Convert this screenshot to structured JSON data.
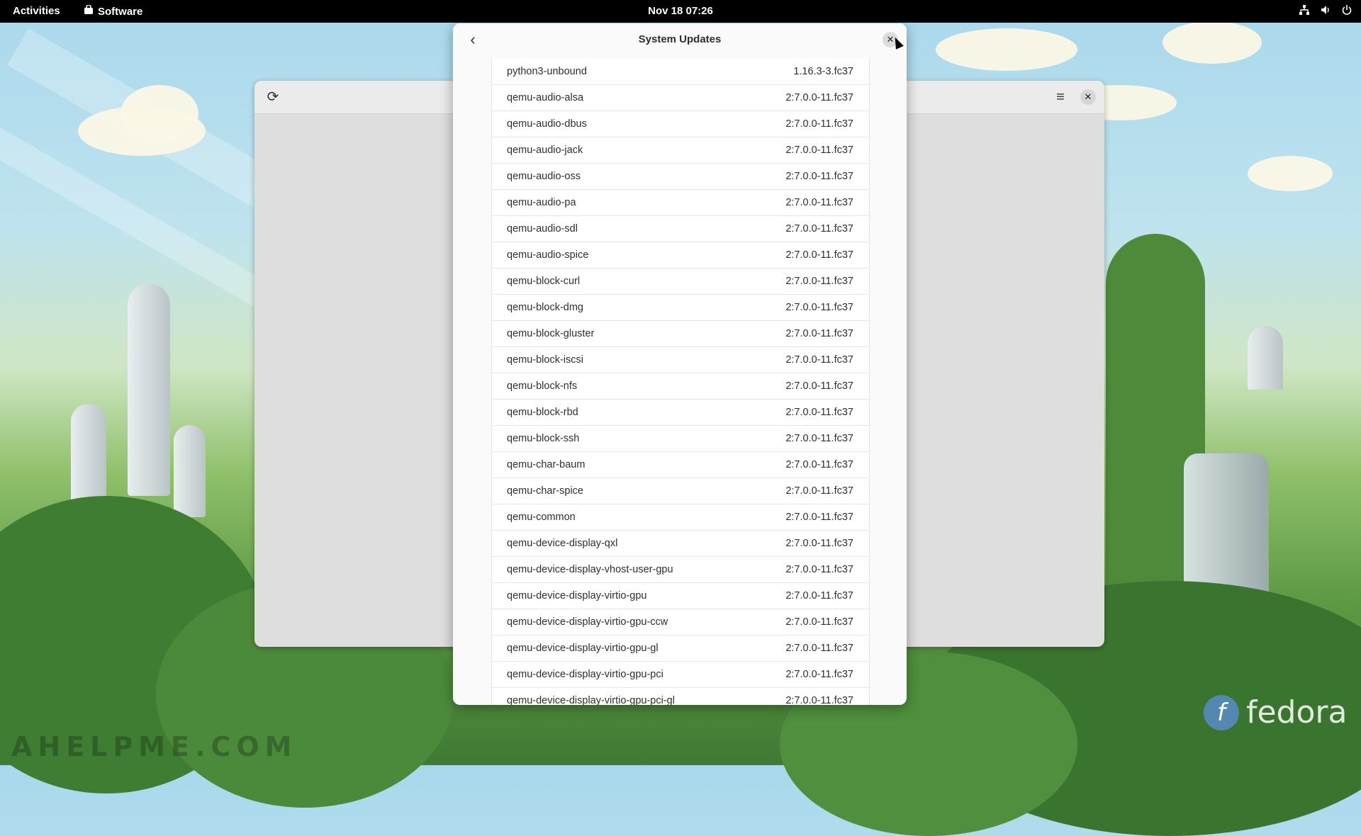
{
  "topbar": {
    "activities": "Activities",
    "app_name": "Software",
    "clock": "Nov 18  07:26"
  },
  "dialog": {
    "title": "System Updates"
  },
  "packages": [
    {
      "name": "python3-unbound",
      "version": "1.16.3-3.fc37"
    },
    {
      "name": "qemu-audio-alsa",
      "version": "2:7.0.0-11.fc37"
    },
    {
      "name": "qemu-audio-dbus",
      "version": "2:7.0.0-11.fc37"
    },
    {
      "name": "qemu-audio-jack",
      "version": "2:7.0.0-11.fc37"
    },
    {
      "name": "qemu-audio-oss",
      "version": "2:7.0.0-11.fc37"
    },
    {
      "name": "qemu-audio-pa",
      "version": "2:7.0.0-11.fc37"
    },
    {
      "name": "qemu-audio-sdl",
      "version": "2:7.0.0-11.fc37"
    },
    {
      "name": "qemu-audio-spice",
      "version": "2:7.0.0-11.fc37"
    },
    {
      "name": "qemu-block-curl",
      "version": "2:7.0.0-11.fc37"
    },
    {
      "name": "qemu-block-dmg",
      "version": "2:7.0.0-11.fc37"
    },
    {
      "name": "qemu-block-gluster",
      "version": "2:7.0.0-11.fc37"
    },
    {
      "name": "qemu-block-iscsi",
      "version": "2:7.0.0-11.fc37"
    },
    {
      "name": "qemu-block-nfs",
      "version": "2:7.0.0-11.fc37"
    },
    {
      "name": "qemu-block-rbd",
      "version": "2:7.0.0-11.fc37"
    },
    {
      "name": "qemu-block-ssh",
      "version": "2:7.0.0-11.fc37"
    },
    {
      "name": "qemu-char-baum",
      "version": "2:7.0.0-11.fc37"
    },
    {
      "name": "qemu-char-spice",
      "version": "2:7.0.0-11.fc37"
    },
    {
      "name": "qemu-common",
      "version": "2:7.0.0-11.fc37"
    },
    {
      "name": "qemu-device-display-qxl",
      "version": "2:7.0.0-11.fc37"
    },
    {
      "name": "qemu-device-display-vhost-user-gpu",
      "version": "2:7.0.0-11.fc37"
    },
    {
      "name": "qemu-device-display-virtio-gpu",
      "version": "2:7.0.0-11.fc37"
    },
    {
      "name": "qemu-device-display-virtio-gpu-ccw",
      "version": "2:7.0.0-11.fc37"
    },
    {
      "name": "qemu-device-display-virtio-gpu-gl",
      "version": "2:7.0.0-11.fc37"
    },
    {
      "name": "qemu-device-display-virtio-gpu-pci",
      "version": "2:7.0.0-11.fc37"
    },
    {
      "name": "qemu-device-display-virtio-gpu-pci-gl",
      "version": "2:7.0.0-11.fc37"
    }
  ],
  "wallpaper": {
    "watermark": "AHELPME.COM",
    "brand": "fedora",
    "brand_mark": "f"
  },
  "colors": {
    "topbar_bg": "#000000",
    "dialog_bg": "#fafafa",
    "row_border": "#e6e6e6"
  }
}
